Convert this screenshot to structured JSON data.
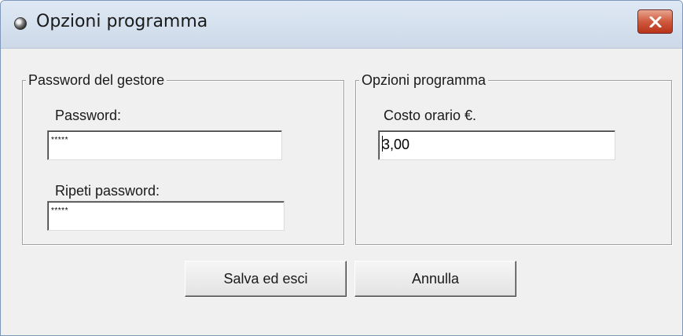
{
  "window": {
    "title": "Opzioni programma",
    "close_label": "Close"
  },
  "password_group": {
    "legend": "Password del gestore",
    "password_label": "Password:",
    "password_value": "*****",
    "repeat_label": "Ripeti password:",
    "repeat_value": "*****"
  },
  "options_group": {
    "legend": "Opzioni programma",
    "cost_label": "Costo orario €.",
    "cost_value": "3,00"
  },
  "buttons": {
    "save_label": "Salva ed esci",
    "cancel_label": "Annulla"
  },
  "icons": {
    "app": "app-orb-icon",
    "close": "close-icon"
  },
  "colors": {
    "close_button": "#cf5a3e",
    "titlebar": "#dfe9f5",
    "dialog_background": "#f0f0f0"
  }
}
